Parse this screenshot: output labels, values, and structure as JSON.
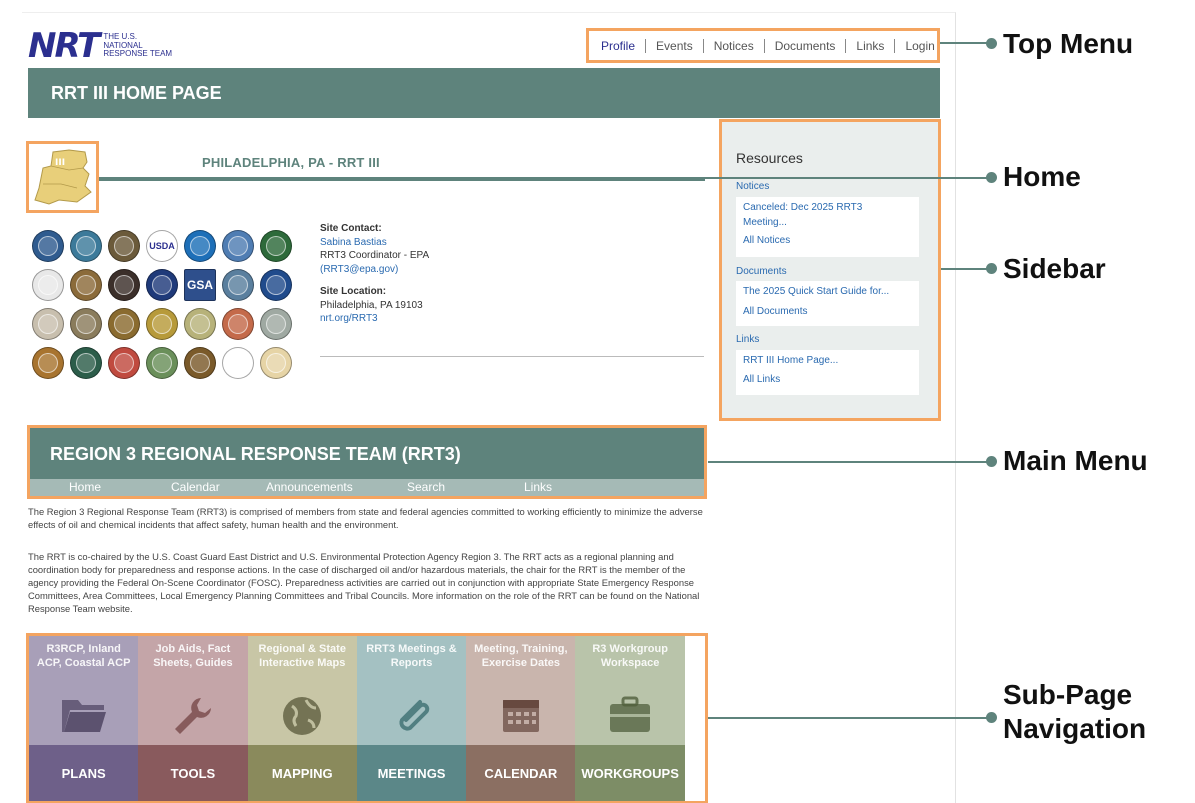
{
  "logo": {
    "mark": "NRT",
    "text_lines": [
      "THE U.S.",
      "NATIONAL",
      "RESPONSE TEAM"
    ]
  },
  "top_menu": [
    "Profile",
    "Events",
    "Notices",
    "Documents",
    "Links",
    "Login"
  ],
  "page_title": "RRT III HOME PAGE",
  "home": {
    "map_label": "III",
    "title": "PHILADELPHIA, PA - RRT III"
  },
  "contact": {
    "site_contact_label": "Site Contact:",
    "name": "Sabina Bastias",
    "role": "RRT3 Coordinator - EPA",
    "email": "(RRT3@epa.gov)",
    "site_location_label": "Site Location:",
    "location": "Philadelphia, PA 19103",
    "url": "nrt.org/RRT3"
  },
  "seals": [
    {
      "name": "seal-1",
      "color": "#2f5b8f"
    },
    {
      "name": "seal-2",
      "color": "#3c7a9a"
    },
    {
      "name": "seal-3",
      "color": "#6b5a3a"
    },
    {
      "name": "usda",
      "color": "#ffffff",
      "text": "USDA"
    },
    {
      "name": "noaa",
      "color": "#1d6fb8"
    },
    {
      "name": "seal-6",
      "color": "#4f7db3"
    },
    {
      "name": "seal-7",
      "color": "#2d6a3a"
    },
    {
      "name": "seal-8",
      "color": "#e8e8e8"
    },
    {
      "name": "seal-9",
      "color": "#8b6b3a"
    },
    {
      "name": "seal-10",
      "color": "#3b2f2a"
    },
    {
      "name": "seal-11",
      "color": "#1f3a7a"
    },
    {
      "name": "gsa",
      "color": "#2e4f8c",
      "text": "GSA"
    },
    {
      "name": "seal-13",
      "color": "#5a7f9e"
    },
    {
      "name": "seal-14",
      "color": "#204b8c"
    },
    {
      "name": "seal-15",
      "color": "#c8bfae"
    },
    {
      "name": "seal-16",
      "color": "#8a7c5c"
    },
    {
      "name": "seal-17",
      "color": "#8a6b2f"
    },
    {
      "name": "seal-18",
      "color": "#b79a3a"
    },
    {
      "name": "seal-19",
      "color": "#b7b27a"
    },
    {
      "name": "seal-20",
      "color": "#c46a4a"
    },
    {
      "name": "seal-21",
      "color": "#9fa9a2"
    },
    {
      "name": "seal-22",
      "color": "#a8742f"
    },
    {
      "name": "seal-23",
      "color": "#2c5d4a"
    },
    {
      "name": "seal-24",
      "color": "#c04a3f"
    },
    {
      "name": "seal-25",
      "color": "#6a8f5a"
    },
    {
      "name": "seal-26",
      "color": "#7a5a2a"
    },
    {
      "name": "seal-27",
      "color": "#ffffff"
    },
    {
      "name": "seal-28",
      "color": "#e6d4a6"
    }
  ],
  "sidebar": {
    "title": "Resources",
    "notices_label": "Notices",
    "notices": [
      "Canceled: Dec 2025 RRT3",
      "Meeting...",
      "All Notices"
    ],
    "documents_label": "Documents",
    "documents": [
      "The 2025 Quick Start Guide for...",
      "All Documents"
    ],
    "links_label": "Links",
    "links": [
      "RRT III Home Page...",
      "All Links"
    ]
  },
  "main_menu": {
    "title": "REGION 3 REGIONAL RESPONSE TEAM (RRT3)",
    "items": [
      "Home",
      "Calendar",
      "Announcements",
      "Search",
      "Links"
    ]
  },
  "paragraph1": "The Region 3 Regional Response Team (RRT3) is comprised of members from state and federal agencies committed to working efficiently to minimize the adverse effects of oil and chemical incidents that affect safety, human health and the environment.",
  "paragraph2": "The RRT is co-chaired by the U.S. Coast Guard East District and U.S. Environmental Protection Agency Region 3. The RRT acts as a regional planning and coordination body for preparedness and response actions. In the case of discharged oil and/or hazardous materials, the chair for the RRT is the member of the agency providing the Federal On-Scene Coordinator (FOSC). Preparedness activities are carried out in conjunction with appropriate State Emergency Response Committees, Area Committees, Local Emergency Planning Committees and Tribal Councils. More information on the role of the RRT can be found on the National Response Team website.",
  "subpages": [
    {
      "label": "R3RCP, Inland ACP, Coastal ACP",
      "name": "PLANS",
      "icon": "folder-icon",
      "top_color": "#a89fb8",
      "bottom_color": "#6e6089"
    },
    {
      "label": "Job Aids, Fact Sheets, Guides",
      "name": "TOOLS",
      "icon": "wrench-icon",
      "top_color": "#c4a5a8",
      "bottom_color": "#895a5d"
    },
    {
      "label": "Regional & State Interactive Maps",
      "name": "MAPPING",
      "icon": "globe-icon",
      "top_color": "#c8c6a6",
      "bottom_color": "#8a8a5c"
    },
    {
      "label": "RRT3 Meetings & Reports",
      "name": "MEETINGS",
      "icon": "paperclip-icon",
      "top_color": "#a4c1c2",
      "bottom_color": "#5b8788"
    },
    {
      "label": "Meeting, Training, Exercise Dates",
      "name": "CALENDAR",
      "icon": "calendar-icon",
      "top_color": "#c9b5ad",
      "bottom_color": "#8b6f62"
    },
    {
      "label": "R3 Workgroup Workspace",
      "name": "WORKGROUPS",
      "icon": "briefcase-icon",
      "top_color": "#b9c4aa",
      "bottom_color": "#7d8d66"
    }
  ],
  "annotations": {
    "top_menu": "Top Menu",
    "home": "Home",
    "sidebar": "Sidebar",
    "main_menu": "Main Menu",
    "subpage_nav": "Sub-Page Navigation"
  },
  "colors": {
    "banner": "#5e837c",
    "highlight_border": "#f4a460",
    "link": "#2a6ab0",
    "logo": "#2b2f8f"
  }
}
